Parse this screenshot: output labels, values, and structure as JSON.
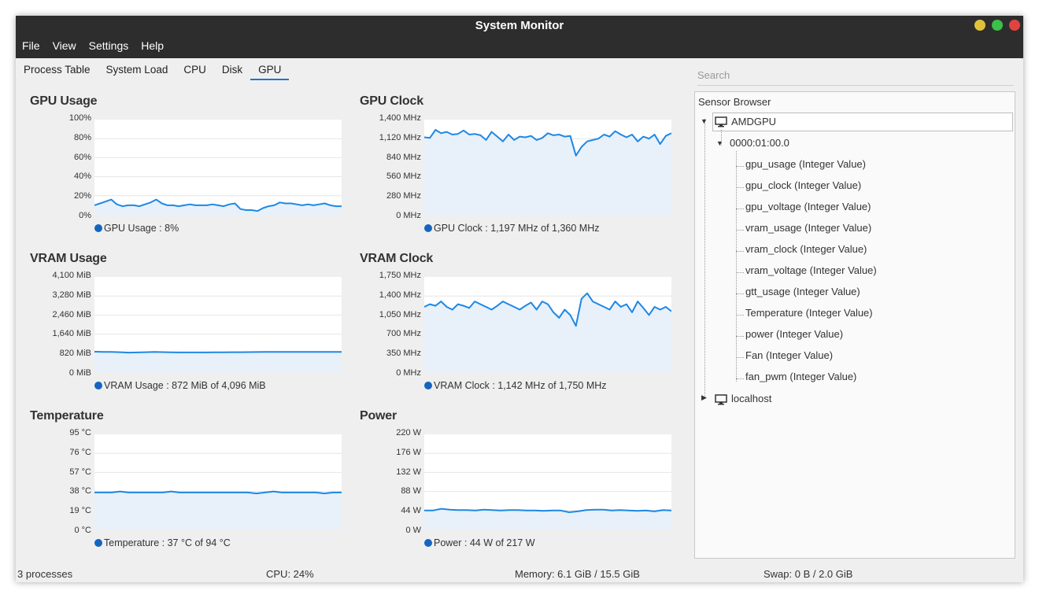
{
  "window": {
    "title": "System Monitor",
    "menu": [
      "File",
      "View",
      "Settings",
      "Help"
    ],
    "buttons": {
      "minimize_color": "#e0c23a",
      "maximize_color": "#3bc04a",
      "close_color": "#e0443e"
    }
  },
  "tabs": [
    {
      "label": "Process Table",
      "active": false
    },
    {
      "label": "System Load",
      "active": false
    },
    {
      "label": "CPU",
      "active": false
    },
    {
      "label": "Disk",
      "active": false
    },
    {
      "label": "GPU",
      "active": true
    }
  ],
  "charts": [
    {
      "title": "GPU Usage",
      "yticks": [
        "100%",
        "80%",
        "60%",
        "40%",
        "20%",
        "0%"
      ],
      "legend": "GPU Usage : 8%",
      "ymax": 100,
      "values": [
        10,
        12,
        14,
        16,
        11,
        9,
        10,
        10,
        9,
        11,
        13,
        16,
        12,
        10,
        10,
        9,
        10,
        11,
        10,
        10,
        10,
        11,
        10,
        9,
        11,
        12,
        6,
        5,
        5,
        4,
        7,
        9,
        10,
        13,
        12,
        12,
        11,
        10,
        11,
        10,
        11,
        12,
        10,
        9,
        9
      ]
    },
    {
      "title": "GPU Clock",
      "yticks": [
        "1,400 MHz",
        "1,120 MHz",
        "840 MHz",
        "560 MHz",
        "280 MHz",
        "0 MHz"
      ],
      "legend": "GPU Clock : 1,197 MHz of 1,360 MHz",
      "ymax": 1400,
      "values": [
        1140,
        1130,
        1250,
        1200,
        1220,
        1180,
        1190,
        1240,
        1180,
        1190,
        1170,
        1100,
        1220,
        1150,
        1080,
        1180,
        1100,
        1150,
        1140,
        1160,
        1100,
        1130,
        1200,
        1170,
        1180,
        1150,
        1160,
        870,
        1000,
        1080,
        1100,
        1120,
        1180,
        1150,
        1230,
        1180,
        1140,
        1180,
        1080,
        1150,
        1120,
        1180,
        1040,
        1160,
        1200
      ]
    },
    {
      "title": "VRAM Usage",
      "yticks": [
        "4,100 MiB",
        "3,280 MiB",
        "2,460 MiB",
        "1,640 MiB",
        "820 MiB",
        "0 MiB"
      ],
      "legend": "VRAM Usage : 872 MiB of 4,096 MiB",
      "ymax": 4100,
      "values": [
        880,
        875,
        870,
        860,
        845,
        850,
        860,
        870,
        865,
        855,
        850,
        850,
        850,
        852,
        855,
        856,
        860,
        862,
        865,
        868,
        870,
        872,
        872,
        872,
        872,
        872,
        872,
        872,
        872,
        872
      ]
    },
    {
      "title": "VRAM Clock",
      "yticks": [
        "1,750 MHz",
        "1,400 MHz",
        "1,050 MHz",
        "700 MHz",
        "350 MHz",
        "0 MHz"
      ],
      "legend": "VRAM Clock : 1,142 MHz of 1,750 MHz",
      "ymax": 1750,
      "values": [
        1200,
        1250,
        1220,
        1300,
        1200,
        1150,
        1250,
        1220,
        1180,
        1300,
        1250,
        1200,
        1150,
        1220,
        1300,
        1250,
        1200,
        1150,
        1220,
        1280,
        1150,
        1300,
        1250,
        1100,
        1000,
        1150,
        1050,
        850,
        1350,
        1450,
        1300,
        1250,
        1200,
        1150,
        1300,
        1200,
        1250,
        1100,
        1300,
        1180,
        1050,
        1200,
        1150,
        1200,
        1120
      ]
    },
    {
      "title": "Temperature",
      "yticks": [
        "95 °C",
        "76 °C",
        "57 °C",
        "38 °C",
        "19 °C",
        "0 °C"
      ],
      "legend": "Temperature : 37 °C of 94 °C",
      "ymax": 95,
      "values": [
        37,
        37,
        37,
        38,
        37,
        37,
        37,
        37,
        37,
        38,
        37,
        37,
        37,
        37,
        37,
        37,
        37,
        37,
        37,
        36,
        37,
        38,
        37,
        37,
        37,
        37,
        37,
        36,
        37,
        37
      ]
    },
    {
      "title": "Power",
      "yticks": [
        "220 W",
        "176 W",
        "132 W",
        "88 W",
        "44 W",
        "0 W"
      ],
      "legend": "Power : 44 W of 217 W",
      "ymax": 220,
      "values": [
        44,
        44,
        48,
        46,
        45,
        45,
        44,
        46,
        45,
        44,
        45,
        45,
        44,
        44,
        43,
        44,
        44,
        40,
        42,
        45,
        46,
        46,
        44,
        45,
        44,
        43,
        44,
        42,
        45,
        44
      ]
    }
  ],
  "search": {
    "placeholder": "Search"
  },
  "sensor_browser": {
    "header": "Sensor Browser",
    "root": "AMDGPU",
    "device": "0000:01:00.0",
    "sensors": [
      "gpu_usage (Integer Value)",
      "gpu_clock (Integer Value)",
      "gpu_voltage (Integer Value)",
      "vram_usage (Integer Value)",
      "vram_clock (Integer Value)",
      "vram_voltage (Integer Value)",
      "gtt_usage (Integer Value)",
      "Temperature (Integer Value)",
      "power (Integer Value)",
      "Fan (Integer Value)",
      "fan_pwm (Integer Value)"
    ],
    "other": "localhost"
  },
  "status": {
    "processes": "3 processes",
    "cpu": "CPU: 24%",
    "memory": "Memory: 6.1 GiB / 15.5 GiB",
    "swap": "Swap: 0 B / 2.0 GiB"
  }
}
